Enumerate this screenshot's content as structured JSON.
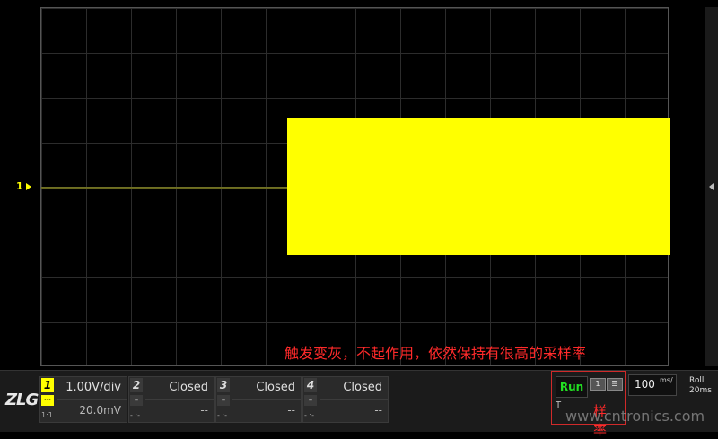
{
  "waveform": {
    "channel_marker": "1",
    "annotation": "触发变灰，不起作用，依然保持有很高的采样率"
  },
  "brand": {
    "logo_text": "ZLG",
    "registered_mark": "®"
  },
  "channels": [
    {
      "number": "1",
      "coupling": "⎓",
      "sub": "1:1",
      "scale": "1.00V/div",
      "offset": "20.0mV"
    },
    {
      "number": "2",
      "coupling": "–",
      "sub": "-.:-",
      "scale": "Closed",
      "offset": "--"
    },
    {
      "number": "3",
      "coupling": "–",
      "sub": "-.:-",
      "scale": "Closed",
      "offset": "--"
    },
    {
      "number": "4",
      "coupling": "–",
      "sub": "-.:-",
      "scale": "Closed",
      "offset": "--"
    }
  ],
  "acquisition": {
    "state": "Run",
    "icon_a": "1",
    "icon_b": "☰",
    "lower_label": "T",
    "sample_label": "样率"
  },
  "timebase": {
    "value": "100",
    "unit": "ms/"
  },
  "mode": {
    "line1": "Roll",
    "line2": "20ms"
  },
  "watermark": "www.cntronics.com",
  "colors": {
    "ch1": "#ffff00",
    "run": "#22e022",
    "annotation": "#ff2a2a",
    "background": "#000000"
  }
}
